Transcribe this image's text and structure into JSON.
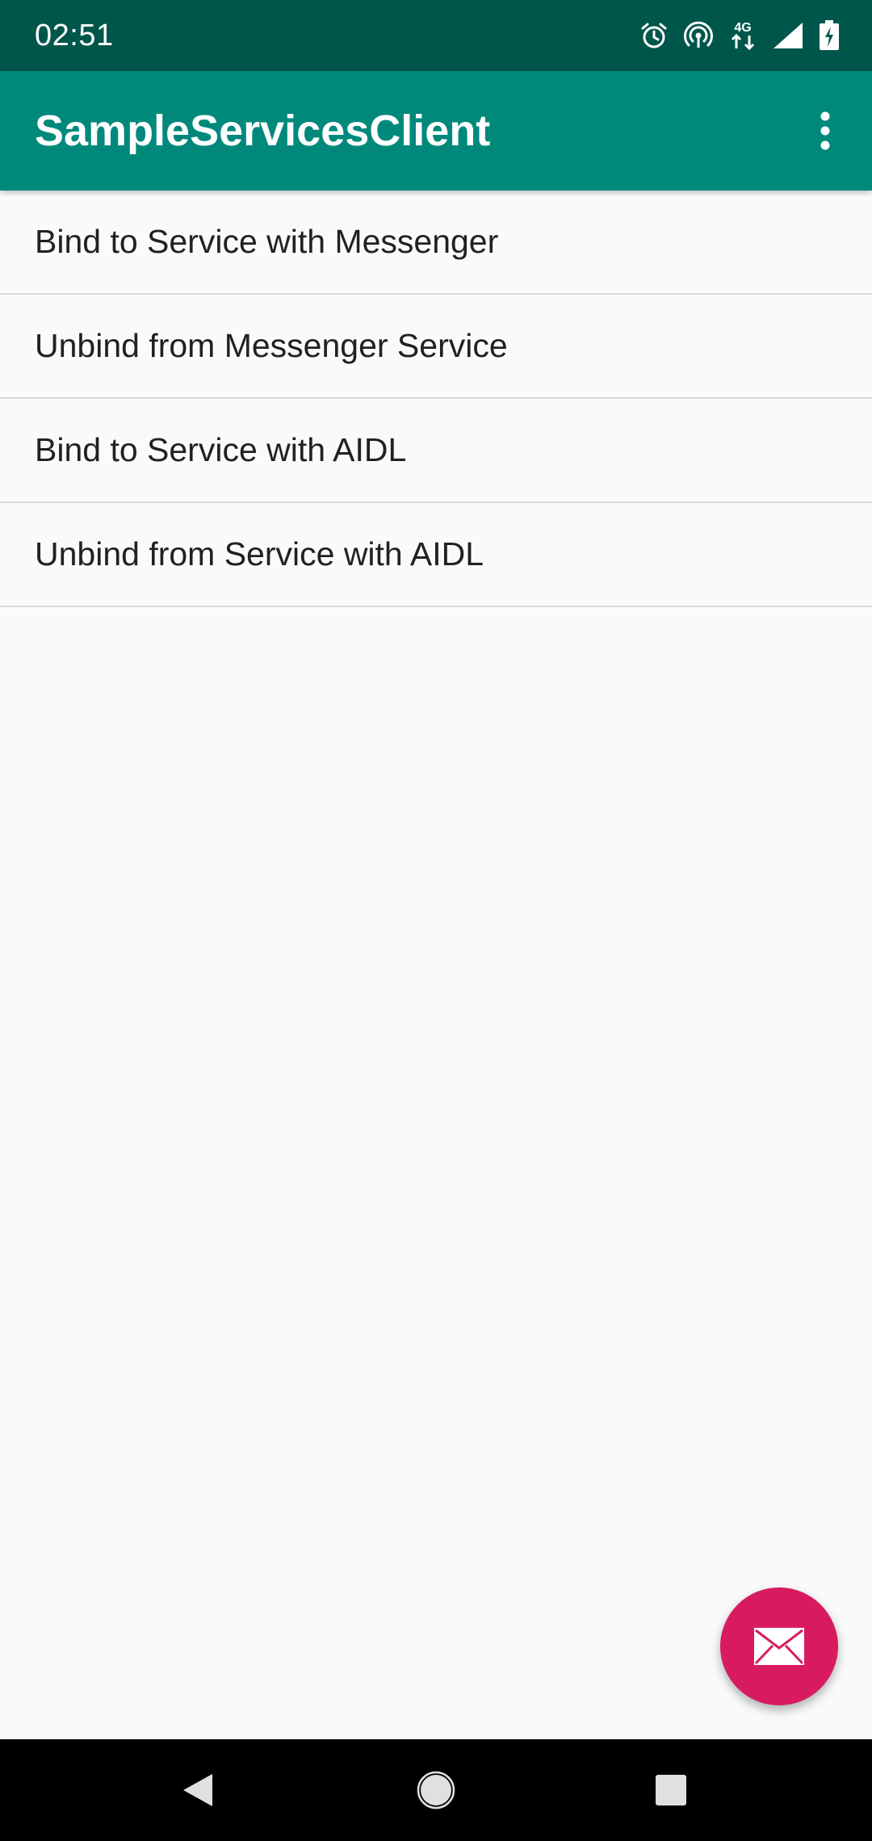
{
  "status_bar": {
    "time": "02:51",
    "icons": [
      "alarm-icon",
      "hotspot-icon",
      "network-4g-icon",
      "cell-signal-icon",
      "battery-icon"
    ],
    "network_label": "4G"
  },
  "app_bar": {
    "title": "SampleServicesClient",
    "overflow_icon": "more-vert-icon"
  },
  "list": {
    "items": [
      {
        "label": "Bind to Service with Messenger"
      },
      {
        "label": "Unbind from Messenger Service"
      },
      {
        "label": "Bind to Service with AIDL"
      },
      {
        "label": "Unbind from Service with AIDL"
      }
    ]
  },
  "fab": {
    "icon": "email-icon",
    "color": "#d81b60"
  },
  "nav_bar": {
    "buttons": [
      "back-icon",
      "home-icon",
      "recents-icon"
    ]
  },
  "colors": {
    "status_bar": "#00564b",
    "app_bar": "#00897b",
    "background": "#fafafa",
    "accent": "#d81b60"
  }
}
